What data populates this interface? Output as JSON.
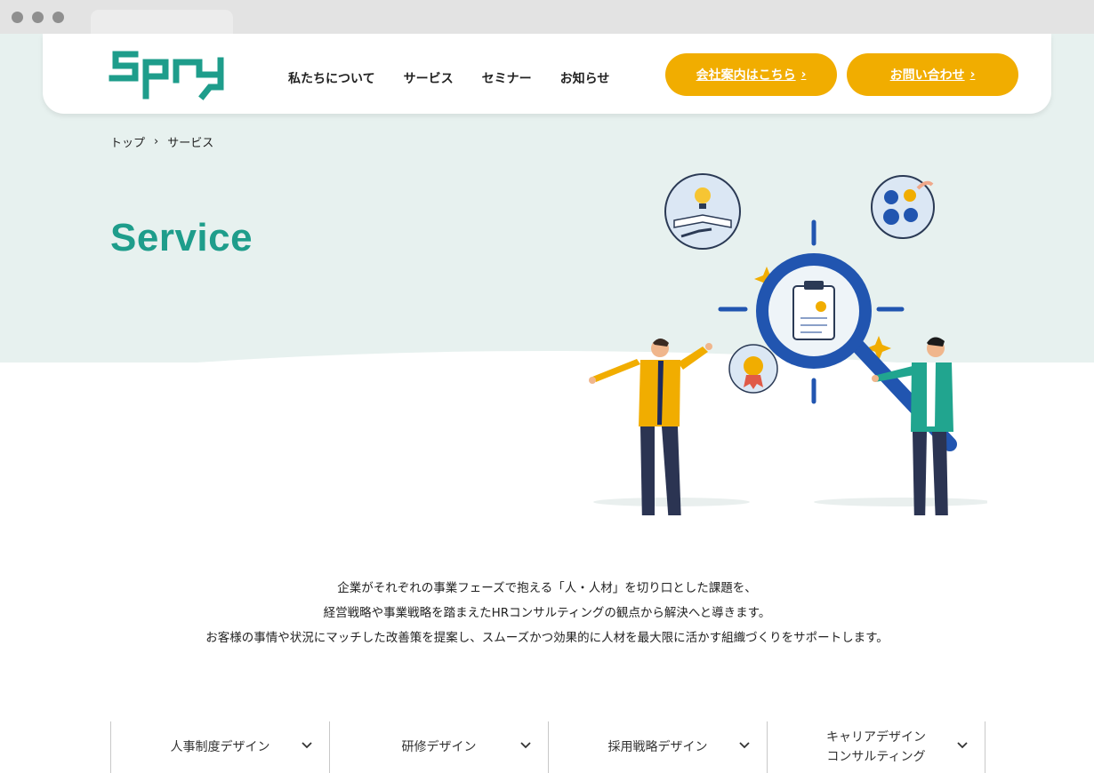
{
  "brand": {
    "logo_text": "Spry",
    "accent": "#1e9d8b",
    "cta_color": "#f1ad00"
  },
  "nav": {
    "items": [
      "私たちについて",
      "サービス",
      "セミナー",
      "お知らせ"
    ]
  },
  "cta": {
    "company": "会社案内はこちら",
    "contact": "お問い合わせ"
  },
  "breadcrumb": {
    "items": [
      "トップ",
      "サービス"
    ]
  },
  "hero": {
    "title": "Service"
  },
  "intro": {
    "lines": [
      "企業がそれぞれの事業フェーズで抱える「人・人材」を切り口とした課題を、",
      "経営戦略や事業戦略を踏まえたHRコンサルティングの観点から解決へと導きます。",
      "お客様の事情や状況にマッチした改善策を提案し、スムーズかつ効果的に人材を最大限に活かす組織づくりをサポートします。"
    ]
  },
  "service_tabs": [
    {
      "label": "人事制度デザイン"
    },
    {
      "label": "研修デザイン"
    },
    {
      "label": "採用戦略デザイン"
    },
    {
      "label": "キャリアデザインコンサルティング",
      "line1": "キャリアデザイン",
      "line2": "コンサルティング"
    }
  ],
  "icons": [
    "chevron-right-icon",
    "chevron-down-icon",
    "lightbulb-book-icon",
    "gears-icon",
    "magnifier-icon",
    "clipboard-icon",
    "award-badge-icon",
    "sparkle-icon"
  ]
}
